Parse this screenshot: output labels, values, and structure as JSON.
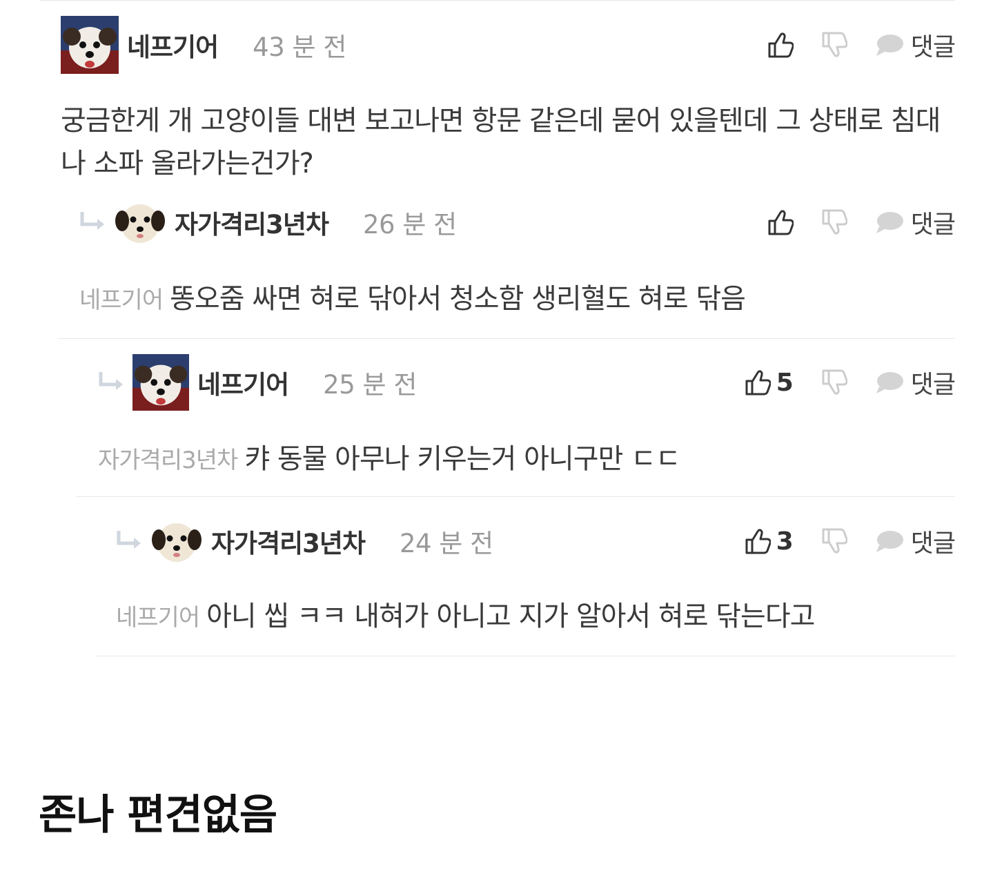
{
  "comments": [
    {
      "nickname": "네프기어",
      "time": "43 분 전",
      "like_count": "",
      "reply_label": "댓글",
      "mention": "",
      "text": "궁금한게 개 고양이들 대변 보고나면 항문 같은데 묻어 있을텐데 그 상태로 침대나 소파 올라가는건가?",
      "avatar": "dog-avatar-dark-icon"
    },
    {
      "nickname": "자가격리3년차",
      "time": "26 분 전",
      "like_count": "",
      "reply_label": "댓글",
      "mention": "네프기어",
      "text": "똥오줌 싸면 혀로 닦아서 청소함 생리혈도 혀로 닦음",
      "avatar": "puppy-avatar-icon"
    },
    {
      "nickname": "네프기어",
      "time": "25 분 전",
      "like_count": "5",
      "reply_label": "댓글",
      "mention": "자가격리3년차",
      "text": "캬 동물 아무나 키우는거 아니구만 ㄷㄷ",
      "avatar": "dog-avatar-dark-icon"
    },
    {
      "nickname": "자가격리3년차",
      "time": "24 분 전",
      "like_count": "3",
      "reply_label": "댓글",
      "mention": "네프기어",
      "text": "아니 씹 ㅋㅋ 내혀가 아니고 지가 알아서 혀로 닦는다고",
      "avatar": "puppy-avatar-icon"
    }
  ],
  "caption": "존나 편견없음",
  "colors": {
    "meta_gray": "#999999",
    "icon_gray": "#cccccc",
    "text_dark": "#333333"
  }
}
